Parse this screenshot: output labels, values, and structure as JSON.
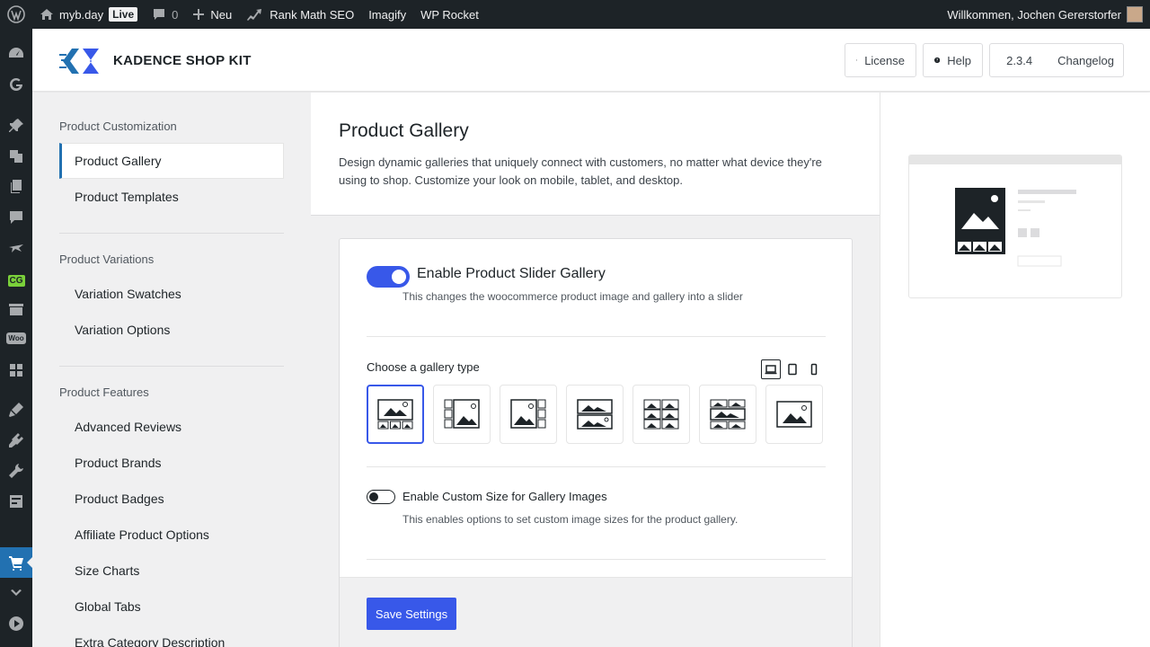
{
  "adminbar": {
    "site_name": "myb.day",
    "live_label": "Live",
    "comments_count": "0",
    "new_label": "Neu",
    "rankmath_label": "Rank Math SEO",
    "imagify_label": "Imagify",
    "wprocket_label": "WP Rocket",
    "greeting": "Willkommen, Jochen Gererstorfer"
  },
  "adminmenu": {
    "cg_badge": "CG",
    "woo_badge": "Woo"
  },
  "header": {
    "brand": "KADENCE SHOP KIT",
    "license_label": "License",
    "help_label": "Help",
    "version": "2.3.4",
    "changelog_label": "Changelog"
  },
  "sidebar": {
    "groups": [
      {
        "title": "Product Customization",
        "items": [
          "Product Gallery",
          "Product Templates"
        ]
      },
      {
        "title": "Product Variations",
        "items": [
          "Variation Swatches",
          "Variation Options"
        ]
      },
      {
        "title": "Product Features",
        "items": [
          "Advanced Reviews",
          "Product Brands",
          "Product Badges",
          "Affiliate Product Options",
          "Size Charts",
          "Global Tabs",
          "Extra Category Description"
        ]
      }
    ],
    "active_item": "Product Gallery"
  },
  "main": {
    "title": "Product Gallery",
    "description": "Design dynamic galleries that uniquely connect with customers, no matter what device they're using to shop. Customize your look on mobile, tablet, and desktop.",
    "slider_toggle": {
      "label": "Enable Product Slider Gallery",
      "help": "This changes the woocommerce product image and gallery into a slider",
      "enabled": true
    },
    "gallery_type_label": "Choose a gallery type",
    "gallery_types": [
      "thumbs-below",
      "thumbs-left",
      "thumbs-right",
      "stacked",
      "grid",
      "grid-large",
      "single"
    ],
    "gallery_type_selected": 0,
    "device_selected": "desktop",
    "custom_size_toggle": {
      "label": "Enable Custom Size for Gallery Images",
      "help": "This enables options to set custom image sizes for the product gallery.",
      "enabled": false
    },
    "save_label": "Save Settings"
  },
  "colors": {
    "accent": "#3858e9",
    "wp_blue": "#2271b1",
    "admin_dark": "#1d2327"
  }
}
